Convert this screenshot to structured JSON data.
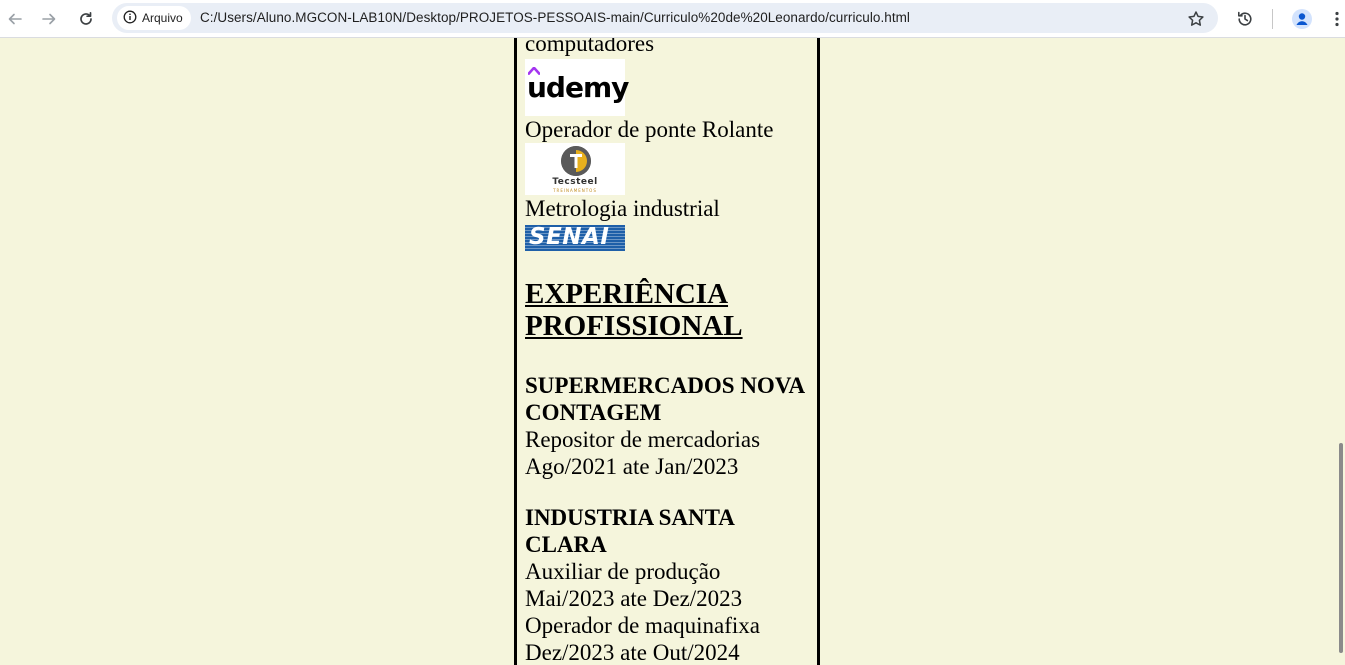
{
  "browser": {
    "security_chip": "Arquivo",
    "url": "C:/Users/Aluno.MGCON-LAB10N/Desktop/PROJETOS-PESSOAIS-main/Curriculo%20de%20Leonardo/curriculo.html",
    "icons": [
      "back-icon",
      "forward-icon",
      "reload-icon",
      "info-icon",
      "star-icon",
      "history-icon",
      "profile-icon",
      "menu-icon"
    ]
  },
  "courses": {
    "partial_line": "computadores",
    "items": [
      {
        "name": "Operador de ponte Rolante",
        "logo_text": "Tecsteel",
        "logo_subtext": "TREINAMENTOS"
      },
      {
        "name": "Metrologia industrial",
        "logo_text": "SENAI"
      }
    ],
    "udemy_logo_text": "ûdemy"
  },
  "experience": {
    "title": "EXPERIÊNCIA PROFISSIONAL",
    "jobs": [
      {
        "company": "SUPERMERCADOS NOVA CONTAGEM",
        "roles": [
          {
            "role": "Repositor de mercadorias",
            "period": "Ago/2021 ate Jan/2023"
          }
        ]
      },
      {
        "company": "INDUSTRIA SANTA CLARA",
        "roles": [
          {
            "role": "Auxiliar de produção",
            "period": "Mai/2023 ate Dez/2023"
          },
          {
            "role": "Operador de maquinafixa",
            "period": "Dez/2023 ate Out/2024"
          }
        ]
      }
    ]
  },
  "colors": {
    "page_background": "#f5f5dc",
    "senai_blue": "#1e5fa8",
    "udemy_purple": "#a435f0",
    "tecsteel_gold": "#e7b01e"
  }
}
